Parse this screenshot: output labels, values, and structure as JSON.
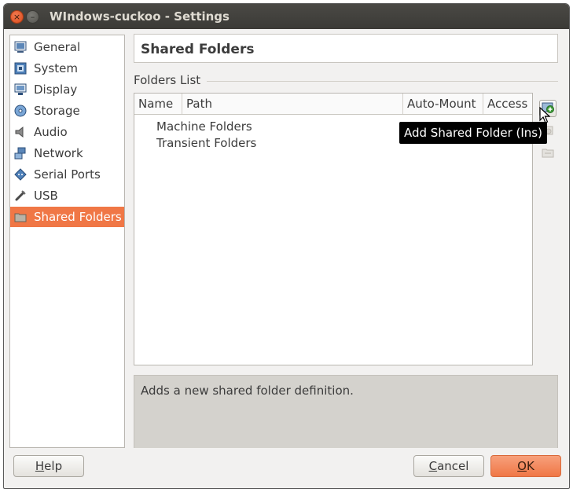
{
  "window": {
    "title": "WIndows-cuckoo - Settings",
    "close_glyph": "×",
    "minimize_glyph": "–"
  },
  "sidebar": {
    "items": [
      {
        "label": "General",
        "icon": "general-icon"
      },
      {
        "label": "System",
        "icon": "system-icon"
      },
      {
        "label": "Display",
        "icon": "display-icon"
      },
      {
        "label": "Storage",
        "icon": "storage-icon"
      },
      {
        "label": "Audio",
        "icon": "audio-icon"
      },
      {
        "label": "Network",
        "icon": "network-icon"
      },
      {
        "label": "Serial Ports",
        "icon": "serial-ports-icon"
      },
      {
        "label": "USB",
        "icon": "usb-icon"
      },
      {
        "label": "Shared Folders",
        "icon": "shared-folders-icon",
        "active": true
      }
    ]
  },
  "main": {
    "header": "Shared Folders",
    "group_label": "Folders List",
    "columns": [
      "Name",
      "Path",
      "Auto-Mount",
      "Access"
    ],
    "rows": [
      "Machine Folders",
      "Transient Folders"
    ],
    "tooltip": "Add Shared Folder (Ins)",
    "description": "Adds a new shared folder definition."
  },
  "footer": {
    "help": {
      "underline": "H",
      "rest": "elp"
    },
    "cancel": {
      "underline": "C",
      "rest": "ancel"
    },
    "ok": {
      "underline": "O",
      "rest": "K"
    }
  },
  "colors": {
    "accent": "#f07746",
    "titlebar": "#3b3a36",
    "window_bg": "#f2f1f0"
  }
}
